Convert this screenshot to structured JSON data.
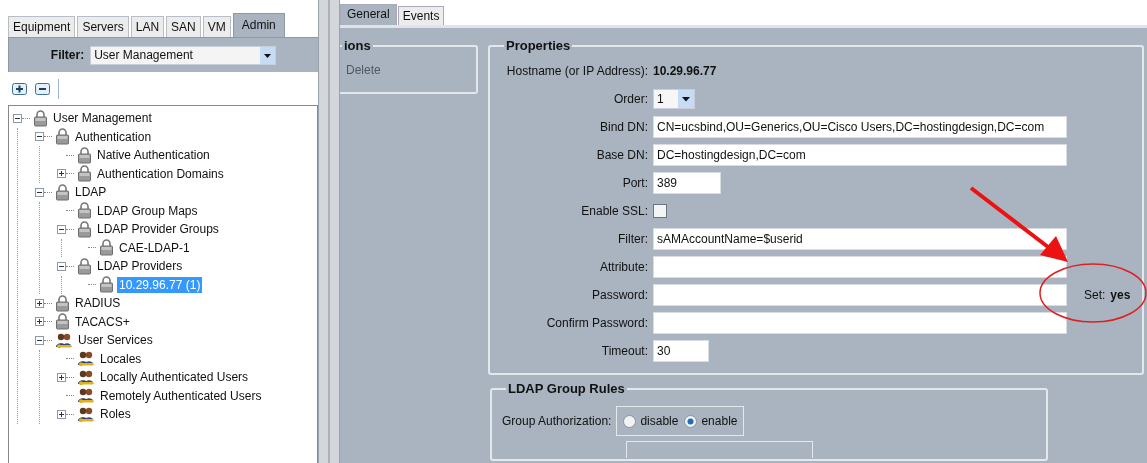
{
  "nav_tabs": [
    {
      "label": "Equipment",
      "selected": false
    },
    {
      "label": "Servers",
      "selected": false
    },
    {
      "label": "LAN",
      "selected": false
    },
    {
      "label": "SAN",
      "selected": false
    },
    {
      "label": "VM",
      "selected": false
    },
    {
      "label": "Admin",
      "selected": true
    }
  ],
  "filter": {
    "label": "Filter:",
    "value": "User Management"
  },
  "tree": [
    {
      "label": "User Management",
      "kind": "lock",
      "expanded": true,
      "selected": false,
      "children": [
        {
          "label": "Authentication",
          "kind": "lock",
          "expanded": true,
          "selected": false,
          "children": [
            {
              "label": "Native Authentication",
              "kind": "lock",
              "selected": false
            },
            {
              "label": "Authentication Domains",
              "kind": "lock",
              "expanded": false,
              "selected": false
            }
          ]
        },
        {
          "label": "LDAP",
          "kind": "lock",
          "expanded": true,
          "selected": false,
          "children": [
            {
              "label": "LDAP Group Maps",
              "kind": "lock",
              "selected": false
            },
            {
              "label": "LDAP Provider Groups",
              "kind": "lock",
              "expanded": true,
              "selected": false,
              "children": [
                {
                  "label": "CAE-LDAP-1",
                  "kind": "lock",
                  "selected": false
                }
              ]
            },
            {
              "label": "LDAP Providers",
              "kind": "lock",
              "expanded": true,
              "selected": false,
              "children": [
                {
                  "label": "10.29.96.77 (1)",
                  "kind": "lock",
                  "selected": true
                }
              ]
            }
          ]
        },
        {
          "label": "RADIUS",
          "kind": "lock",
          "expanded": false,
          "selected": false
        },
        {
          "label": "TACACS+",
          "kind": "lock",
          "expanded": false,
          "selected": false
        },
        {
          "label": "User Services",
          "kind": "users",
          "expanded": true,
          "selected": false,
          "children": [
            {
              "label": "Locales",
              "kind": "users",
              "selected": false
            },
            {
              "label": "Locally Authenticated Users",
              "kind": "users",
              "expanded": false,
              "selected": false
            },
            {
              "label": "Remotely Authenticated Users",
              "kind": "users",
              "selected": false
            },
            {
              "label": "Roles",
              "kind": "users",
              "expanded": false,
              "selected": false
            }
          ]
        }
      ]
    }
  ],
  "detail_tabs": [
    {
      "label": "General",
      "selected": true
    },
    {
      "label": "Events",
      "selected": false
    }
  ],
  "actions": {
    "title": "ions",
    "items": [
      {
        "label": "Delete",
        "disabled": true
      }
    ]
  },
  "properties": {
    "title": "Properties",
    "rows": [
      {
        "kind": "static",
        "label": "Hostname (or IP Address):",
        "value": "10.29.96.77"
      },
      {
        "kind": "select",
        "label": "Order:",
        "value": "1"
      },
      {
        "kind": "field",
        "label": "Bind DN:",
        "value": "CN=ucsbind,OU=Generics,OU=Cisco Users,DC=hostingdesign,DC=com"
      },
      {
        "kind": "field",
        "label": "Base DN:",
        "value": "DC=hostingdesign,DC=com"
      },
      {
        "kind": "short-field",
        "label": "Port:",
        "value": "389"
      },
      {
        "kind": "checkbox",
        "label": "Enable SSL:",
        "checked": false
      },
      {
        "kind": "field",
        "label": "Filter:",
        "value": "sAMAccountName=$userid"
      },
      {
        "kind": "field",
        "label": "Attribute:"
      },
      {
        "kind": "field",
        "label": "Password:",
        "set_label": "Set:",
        "set_value": "yes"
      },
      {
        "kind": "field",
        "label": "Confirm Password:"
      },
      {
        "kind": "tiny-field",
        "label": "Timeout:",
        "value": "30"
      }
    ]
  },
  "group_rules": {
    "title": "LDAP Group Rules",
    "rows": [
      {
        "label": "Group Authorization:",
        "options": [
          {
            "label": "disable",
            "selected": false
          },
          {
            "label": "enable",
            "selected": true
          }
        ]
      }
    ]
  }
}
